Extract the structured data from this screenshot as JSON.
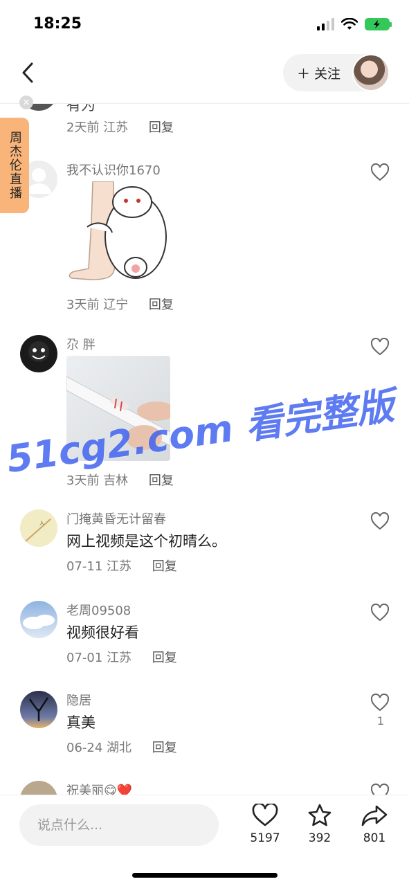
{
  "status_bar": {
    "time": "18:25"
  },
  "nav": {
    "follow_label": "＋ 关注"
  },
  "side_tag": {
    "label": "周杰伦直播"
  },
  "partial_top": {
    "meta_time": "2天前",
    "meta_location": "江苏",
    "reply": "回复"
  },
  "comments": [
    {
      "username": "我不认识你1670",
      "text": "",
      "time": "3天前",
      "location": "辽宁",
      "reply": "回复",
      "likes": ""
    },
    {
      "username": "尕 胖",
      "text": "",
      "time": "3天前",
      "location": "吉林",
      "reply": "回复",
      "likes": ""
    },
    {
      "username": "门掩黄昏无计留春",
      "text": "网上视频是这个初晴么。",
      "time": "07-11",
      "location": "江苏",
      "reply": "回复",
      "likes": ""
    },
    {
      "username": "老周09508",
      "text": "视频很好看",
      "time": "07-01",
      "location": "江苏",
      "reply": "回复",
      "likes": ""
    },
    {
      "username": "隐居",
      "text": "真美",
      "time": "06-24",
      "location": "湖北",
      "reply": "回复",
      "likes": "1"
    },
    {
      "username": "祝美丽😋❤️",
      "text": "",
      "time": "",
      "location": "",
      "reply": "",
      "likes": ""
    }
  ],
  "bottom_bar": {
    "input_placeholder": "说点什么...",
    "likes": "5197",
    "favorites": "392",
    "shares": "801"
  },
  "watermark": "51cg2.com 看完整版",
  "colors": {
    "accent_tag": "#f9b47a",
    "watermark": "#3b5ff0",
    "battery": "#34c759"
  }
}
